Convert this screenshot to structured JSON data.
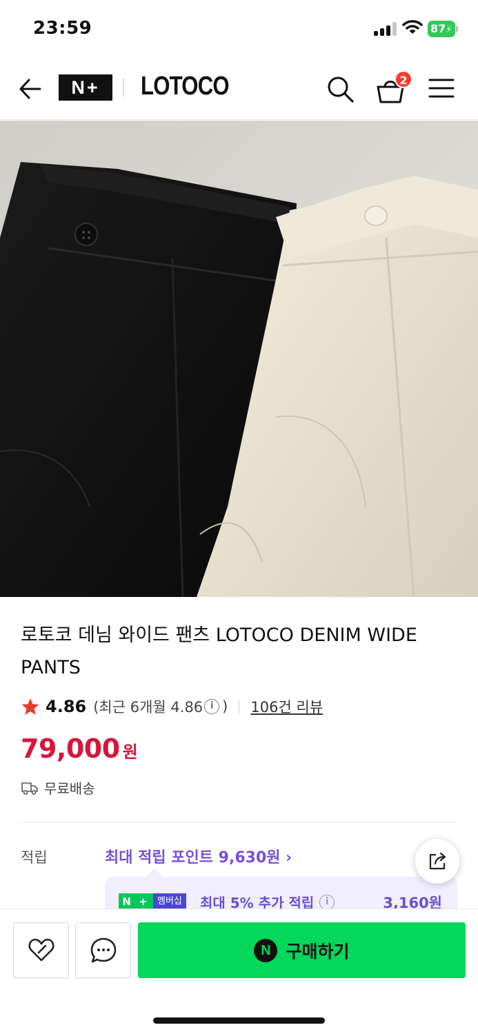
{
  "status_bar": {
    "time": "23:59",
    "battery": "87"
  },
  "header": {
    "logo": "N+",
    "brand": "LOTOCO",
    "cart_count": "2"
  },
  "product": {
    "title": "로토코 데님 와이드 팬츠 LOTOCO DENIM WIDE PANTS",
    "rating": "4.86",
    "rating_recent": "(최근 6개월 4.86",
    "rating_recent_close": ")",
    "reviews": "106건 리뷰",
    "price": "79,000",
    "price_unit": "원",
    "shipping": "무료배송"
  },
  "points": {
    "label": "적립",
    "max_text": "최대 적립 포인트 9,630원 ›",
    "membership_badge_n": "N +",
    "membership_badge_text": "멤버십",
    "membership_text": "최대 5% 추가 적립",
    "membership_amount": "3,160원"
  },
  "bottom": {
    "buy_icon": "N",
    "buy_label": "구매하기"
  },
  "icons": [
    "back-arrow-icon",
    "search-icon",
    "cart-icon",
    "menu-icon",
    "star-icon",
    "info-icon",
    "truck-icon",
    "share-icon",
    "heart-icon",
    "chat-icon",
    "npay-icon"
  ],
  "colors": {
    "price": "#d6163b",
    "points": "#7651d8",
    "buy_button": "#03d85a",
    "badge": "#ff3b30"
  }
}
